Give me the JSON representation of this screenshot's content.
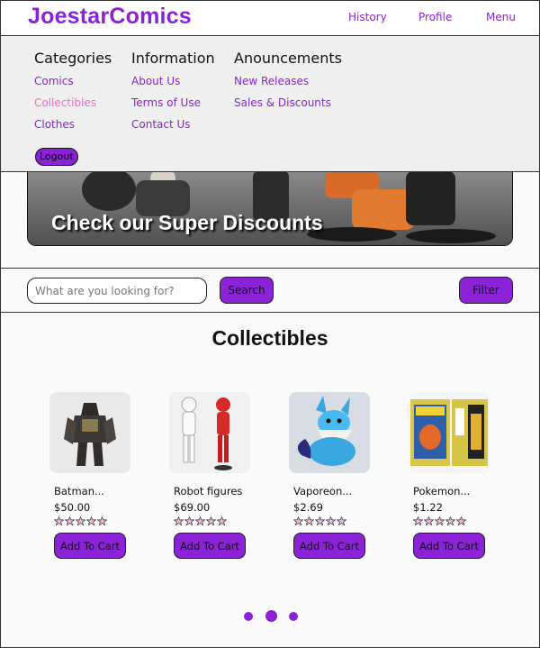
{
  "navbar": {
    "brand": "JoestarComics",
    "links": [
      "History",
      "Profile",
      "Menu"
    ]
  },
  "dropdown": {
    "columns": [
      {
        "title": "Categories",
        "links": [
          "Comics",
          "Collectibles",
          "Clothes"
        ],
        "active": "Collectibles"
      },
      {
        "title": "Information",
        "links": [
          "About Us",
          "Terms of Use",
          "Contact Us"
        ]
      },
      {
        "title": "Anouncements",
        "links": [
          "New Releases",
          "Sales & Discounts"
        ]
      }
    ],
    "logout_label": "Logout"
  },
  "banner": {
    "text": "Check our Super Discounts"
  },
  "search": {
    "placeholder": "What are you looking for?",
    "button_label": "Search",
    "filter_label": "Filter"
  },
  "section": {
    "title": "Collectibles"
  },
  "products": [
    {
      "name": "Batman...",
      "price": "$50.00",
      "rating": 0,
      "max_rating": 5,
      "cta": "Add To Cart",
      "image_icon": "armored-figure-image"
    },
    {
      "name": "Robot figures",
      "price": "$69.00",
      "rating": 0,
      "max_rating": 5,
      "cta": "Add To Cart",
      "image_icon": "robot-figures-image"
    },
    {
      "name": "Vaporeon...",
      "price": "$2.69",
      "rating": 0,
      "max_rating": 5,
      "cta": "Add To Cart",
      "image_icon": "vaporeon-plush-image"
    },
    {
      "name": "Pokemon...",
      "price": "$1.22",
      "rating": 0,
      "max_rating": 5,
      "cta": "Add To Cart",
      "image_icon": "pokemon-card-pack-image"
    }
  ],
  "carousel": {
    "pages": 3,
    "current": 2
  },
  "colors": {
    "accent": "#8a22d6",
    "active_link": "#f06cc8",
    "star_fill": "#f6b8e0"
  }
}
